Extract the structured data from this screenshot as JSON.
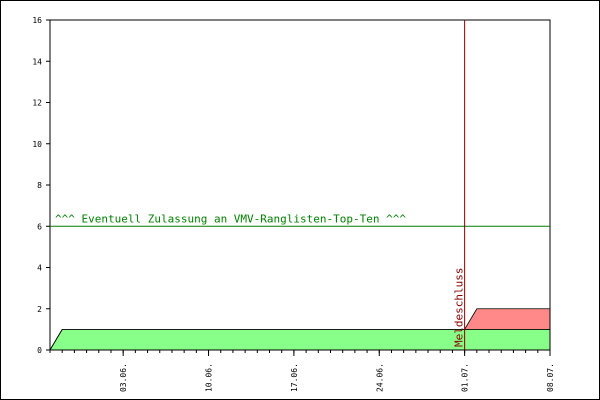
{
  "chart_data": {
    "type": "area",
    "x_dates": [
      "2006-05-28",
      "2006-05-29",
      "2006-07-01",
      "2006-07-02",
      "2006-07-08"
    ],
    "series": [
      {
        "values": [
          0,
          1,
          1,
          1,
          1
        ],
        "color": "#88ff88"
      },
      {
        "values": [
          0,
          0,
          0,
          1,
          1
        ],
        "color": "#ff8888"
      }
    ],
    "xlim": [
      "2006-05-28",
      "2006-07-08"
    ],
    "ylim": [
      0,
      16
    ],
    "y_ticks": [
      0,
      2,
      4,
      6,
      8,
      10,
      12,
      14,
      16
    ],
    "x_ticks": [
      {
        "date": "2006-06-03",
        "label": "03.06."
      },
      {
        "date": "2006-06-10",
        "label": "10.06."
      },
      {
        "date": "2006-06-17",
        "label": "17.06."
      },
      {
        "date": "2006-06-24",
        "label": "24.06."
      },
      {
        "date": "2006-07-01",
        "label": "01.07."
      },
      {
        "date": "2006-07-08",
        "label": "08.07."
      }
    ],
    "threshold": {
      "value": 6,
      "label": "^^^ Eventuell Zulassung an VMV-Ranglisten-Top-Ten ^^^",
      "color": "#008000"
    },
    "deadline": {
      "date": "2006-07-01",
      "label": "Meldeschluss",
      "color": "#8b0000"
    },
    "grid": false
  }
}
